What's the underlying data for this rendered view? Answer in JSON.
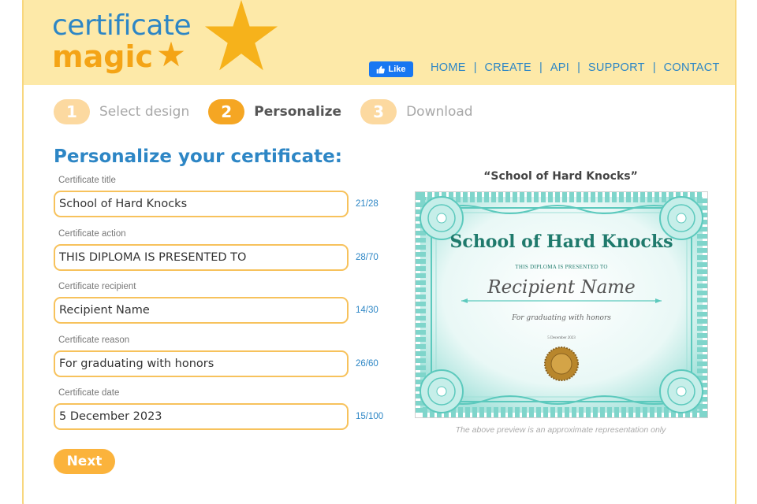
{
  "logo": {
    "line1": "certificate",
    "line2": "magic"
  },
  "fb_like": {
    "label": "Like"
  },
  "nav": {
    "items": [
      "HOME",
      "CREATE",
      "API",
      "SUPPORT",
      "CONTACT"
    ]
  },
  "steps": [
    {
      "number": "1",
      "label": "Select design",
      "active": false
    },
    {
      "number": "2",
      "label": "Personalize",
      "active": true
    },
    {
      "number": "3",
      "label": "Download",
      "active": false
    }
  ],
  "section_title": "Personalize your certificate:",
  "fields": {
    "title": {
      "label": "Certificate title",
      "value": "School of Hard Knocks",
      "count": "21/28"
    },
    "action": {
      "label": "Certificate action",
      "value": "THIS DIPLOMA IS PRESENTED TO",
      "count": "28/70"
    },
    "recipient": {
      "label": "Certificate recipient",
      "value": "Recipient Name",
      "count": "14/30"
    },
    "reason": {
      "label": "Certificate reason",
      "value": "For graduating with honors",
      "count": "26/60"
    },
    "date": {
      "label": "Certificate date",
      "value": "5 December 2023",
      "count": "15/100"
    }
  },
  "next_button": {
    "label": "Next"
  },
  "preview": {
    "title": "“School of Hard Knocks”",
    "note": "The above preview is an approximate representation only",
    "certificate": {
      "title": "School of Hard Knocks",
      "action": "THIS DIPLOMA IS PRESENTED TO",
      "recipient": "Recipient Name",
      "reason": "For graduating with honors",
      "date": "5 December 2023"
    }
  },
  "colors": {
    "header_bg": "#fde9a8",
    "brand_blue": "#2d86c5",
    "brand_orange": "#f4a416",
    "input_border": "#f7c25c",
    "cert_teal": "#5cc9bd",
    "seal_gold": "#b8862c"
  }
}
